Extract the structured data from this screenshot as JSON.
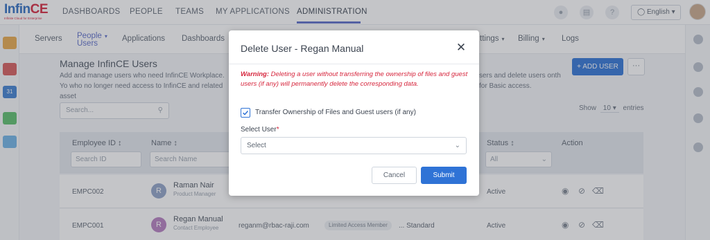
{
  "app": {
    "logo_text": "Infin",
    "logo_accent": "CE",
    "logo_tagline": "Infinite Cloud for Enterprise"
  },
  "topnav": {
    "items": [
      "DASHBOARDS",
      "PEOPLE",
      "TEAMS",
      "MY APPLICATIONS",
      "ADMINISTRATION"
    ],
    "active": "ADMINISTRATION",
    "language": "English",
    "icons": [
      "bell-icon",
      "notes-icon",
      "help-icon",
      "globe-icon"
    ]
  },
  "subnav": {
    "servers": "Servers",
    "people": "People",
    "users": "Users",
    "applications": "Applications",
    "dashboards": "Dashboards",
    "settings_partial": "ttings",
    "billing": "Billing",
    "logs": "Logs"
  },
  "page": {
    "title": "Manage InfinCE Users",
    "desc_left": "Add and manage users who need InfinCE Workplace. Yo who no longer need access to InfinCE and related asset",
    "desc_right": "sers and delete users onth for Basic access.",
    "add_user": "+ ADD USER",
    "more": "···",
    "search_placeholder": "Search...",
    "show_label": "Show",
    "show_value": "10",
    "entries_label": "entries"
  },
  "table": {
    "headers": {
      "employee_id": "Employee ID ↕",
      "name": "Name ↕",
      "status": "Status ↕",
      "action": "Action"
    },
    "filters": {
      "employee_id": "Search ID",
      "name": "Search Name",
      "status": "All"
    },
    "rows": [
      {
        "id": "EMPC002",
        "initial": "R",
        "name": "Raman Nair",
        "role": "Product Manager",
        "email": "",
        "badge": "",
        "plan": "",
        "status": "Active"
      },
      {
        "id": "EMPC001",
        "initial": "R",
        "name": "Regan Manual",
        "role": "Contact Employee",
        "email": "reganm@rbac-raji.com",
        "badge": "Limited Access Member",
        "plan": "... Standard",
        "status": "Active"
      }
    ]
  },
  "modal": {
    "title": "Delete User - Regan Manual",
    "warning_prefix": "Warning:",
    "warning_text": "Deleting a user without transferring the ownership of files and guest users (if any) will permanently delete the corresponding data.",
    "transfer_checked": true,
    "transfer_label": "Transfer Ownership of Files and Guest users (if any)",
    "select_label": "Select User",
    "select_required": "*",
    "select_value": "Select",
    "cancel": "Cancel",
    "submit": "Submit"
  },
  "colors": {
    "primary": "#2f73d6",
    "warning": "#d6263d",
    "nav_active": "#5b6cc9"
  }
}
